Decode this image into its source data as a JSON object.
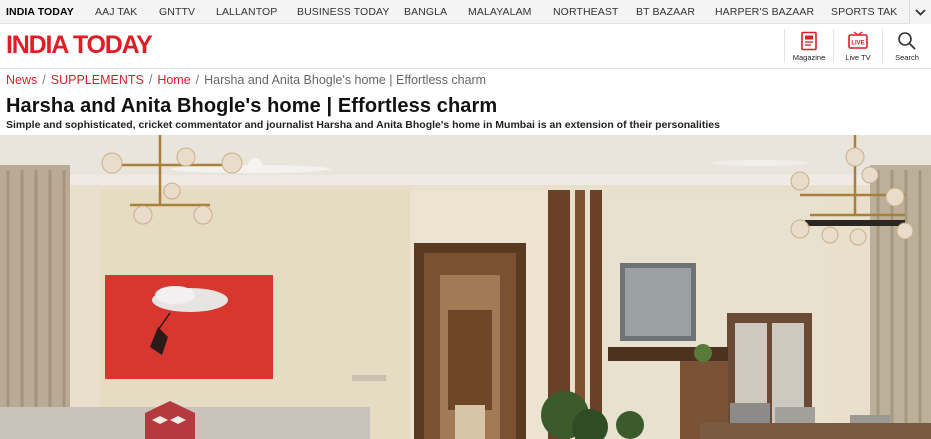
{
  "topnav": {
    "items": [
      {
        "label": "INDIA TODAY",
        "active": true
      },
      {
        "label": "AAJ TAK"
      },
      {
        "label": "GNTTV"
      },
      {
        "label": "LALLANTOP"
      },
      {
        "label": "BUSINESS TODAY"
      },
      {
        "label": "BANGLA"
      },
      {
        "label": "MALAYALAM"
      },
      {
        "label": "NORTHEAST"
      },
      {
        "label": "BT BAZAAR"
      },
      {
        "label": "HARPER'S BAZAAR"
      },
      {
        "label": "SPORTS TAK"
      }
    ],
    "expand_icon": "chevron-down-icon"
  },
  "header": {
    "logo_text": "INDIA TODAY",
    "brand_color": "#e01d25",
    "magazine_label": "Magazine",
    "livetv_label": "Live TV",
    "livetv_badge": "LIVE",
    "search_label": "Search"
  },
  "breadcrumb": {
    "items": [
      "News",
      "SUPPLEMENTS",
      "Home"
    ],
    "separator": "/",
    "current": "Harsha and Anita Bhogle's home | Effortless charm"
  },
  "article": {
    "title": "Harsha and Anita Bhogle's home | Effortless charm",
    "subtitle": "Simple and sophisticated, cricket commentator and journalist Harsha and Anita Bhogle's  home in Mumbai is an extension of their personalities"
  }
}
